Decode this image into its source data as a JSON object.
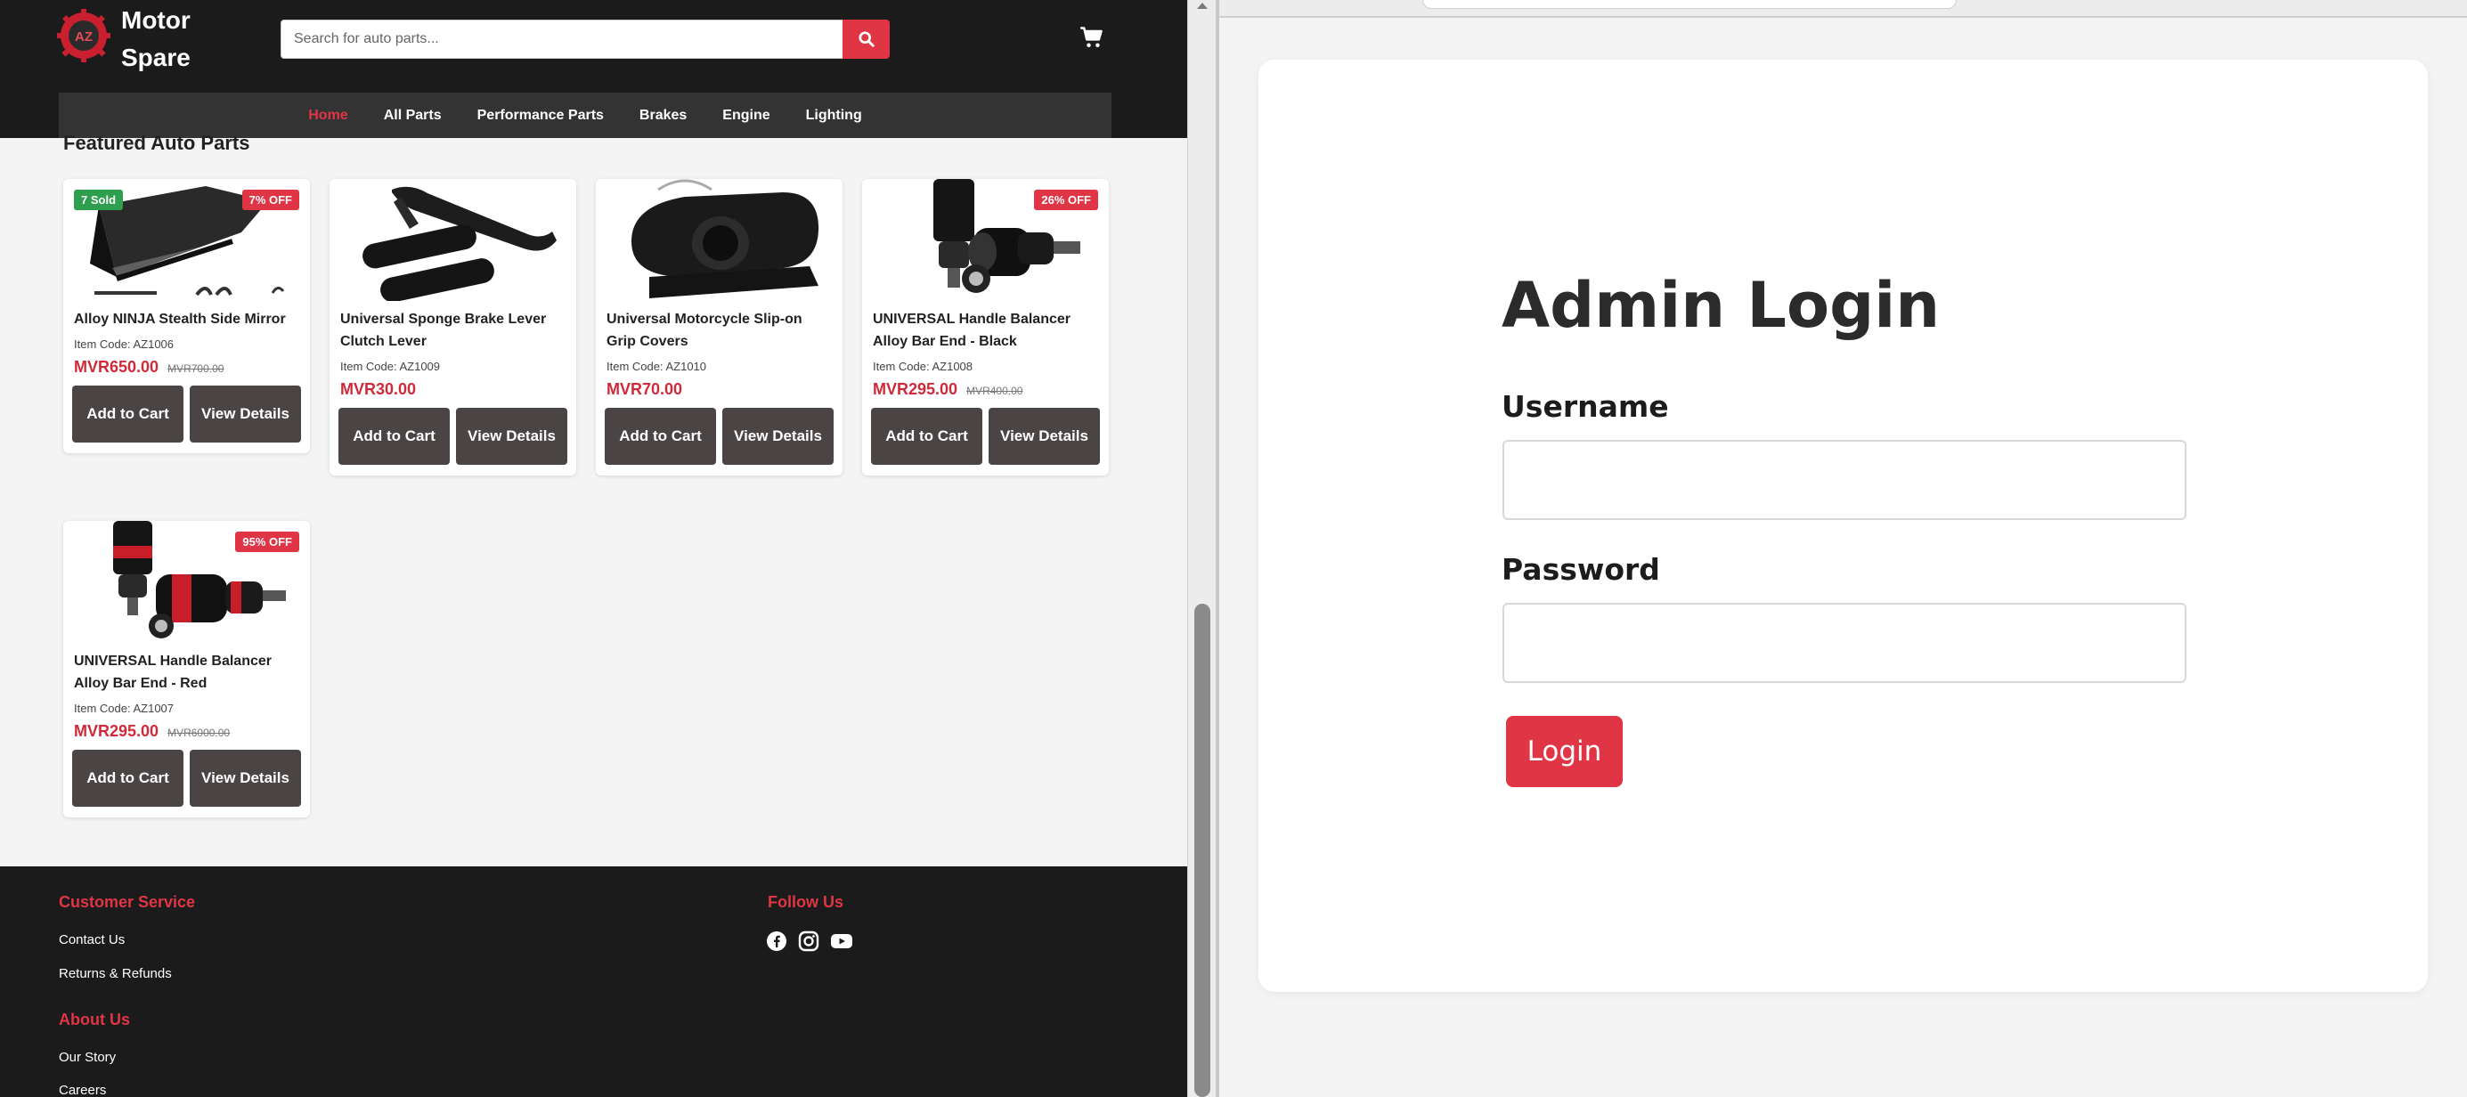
{
  "shop": {
    "brand": {
      "line1": "Motor",
      "line2": "Spare",
      "logo_text": "AZ"
    },
    "search": {
      "placeholder": "Search for auto parts...",
      "value": ""
    },
    "nav": [
      "Home",
      "All Parts",
      "Performance Parts",
      "Brakes",
      "Engine",
      "Lighting"
    ],
    "nav_active": "Home",
    "section_title": "Featured Auto Parts",
    "buttons": {
      "add_to_cart": "Add to Cart",
      "view_details": "View Details"
    },
    "products": [
      {
        "name": "Alloy NINJA Stealth Side Mirror",
        "code": "Item Code: AZ1006",
        "price": "MVR650.00",
        "old_price": "MVR700.00",
        "sold_badge": "7 Sold",
        "discount_badge": "7% OFF"
      },
      {
        "name": "Universal Sponge Brake Lever Clutch Lever",
        "code": "Item Code: AZ1009",
        "price": "MVR30.00",
        "old_price": "",
        "sold_badge": "",
        "discount_badge": ""
      },
      {
        "name": "Universal Motorcycle Slip-on Grip Covers",
        "code": "Item Code: AZ1010",
        "price": "MVR70.00",
        "old_price": "",
        "sold_badge": "",
        "discount_badge": ""
      },
      {
        "name": "UNIVERSAL Handle Balancer Alloy Bar End - Black",
        "code": "Item Code: AZ1008",
        "price": "MVR295.00",
        "old_price": "MVR400.00",
        "sold_badge": "",
        "discount_badge": "26% OFF"
      },
      {
        "name": "UNIVERSAL Handle Balancer Alloy Bar End - Red",
        "code": "Item Code: AZ1007",
        "price": "MVR295.00",
        "old_price": "MVR6000.00",
        "sold_badge": "",
        "discount_badge": "95% OFF"
      }
    ],
    "footer": {
      "customer_service_title": "Customer Service",
      "customer_service_links": [
        "Contact Us",
        "Returns & Refunds"
      ],
      "follow_title": "Follow Us",
      "social_icons": [
        "facebook-icon",
        "instagram-icon",
        "youtube-icon"
      ],
      "about_title": "About Us",
      "about_links": [
        "Our Story",
        "Careers"
      ]
    }
  },
  "admin": {
    "title": "Admin Login",
    "username_label": "Username",
    "username_value": "",
    "password_label": "Password",
    "password_value": "",
    "login_button": "Login"
  },
  "colors": {
    "accent": "#e03545",
    "topbar": "#1b1b1b",
    "navbar": "#333333",
    "button_dark": "#4a4444",
    "price": "#d02a3a",
    "sold_badge": "#2e9e4f"
  }
}
